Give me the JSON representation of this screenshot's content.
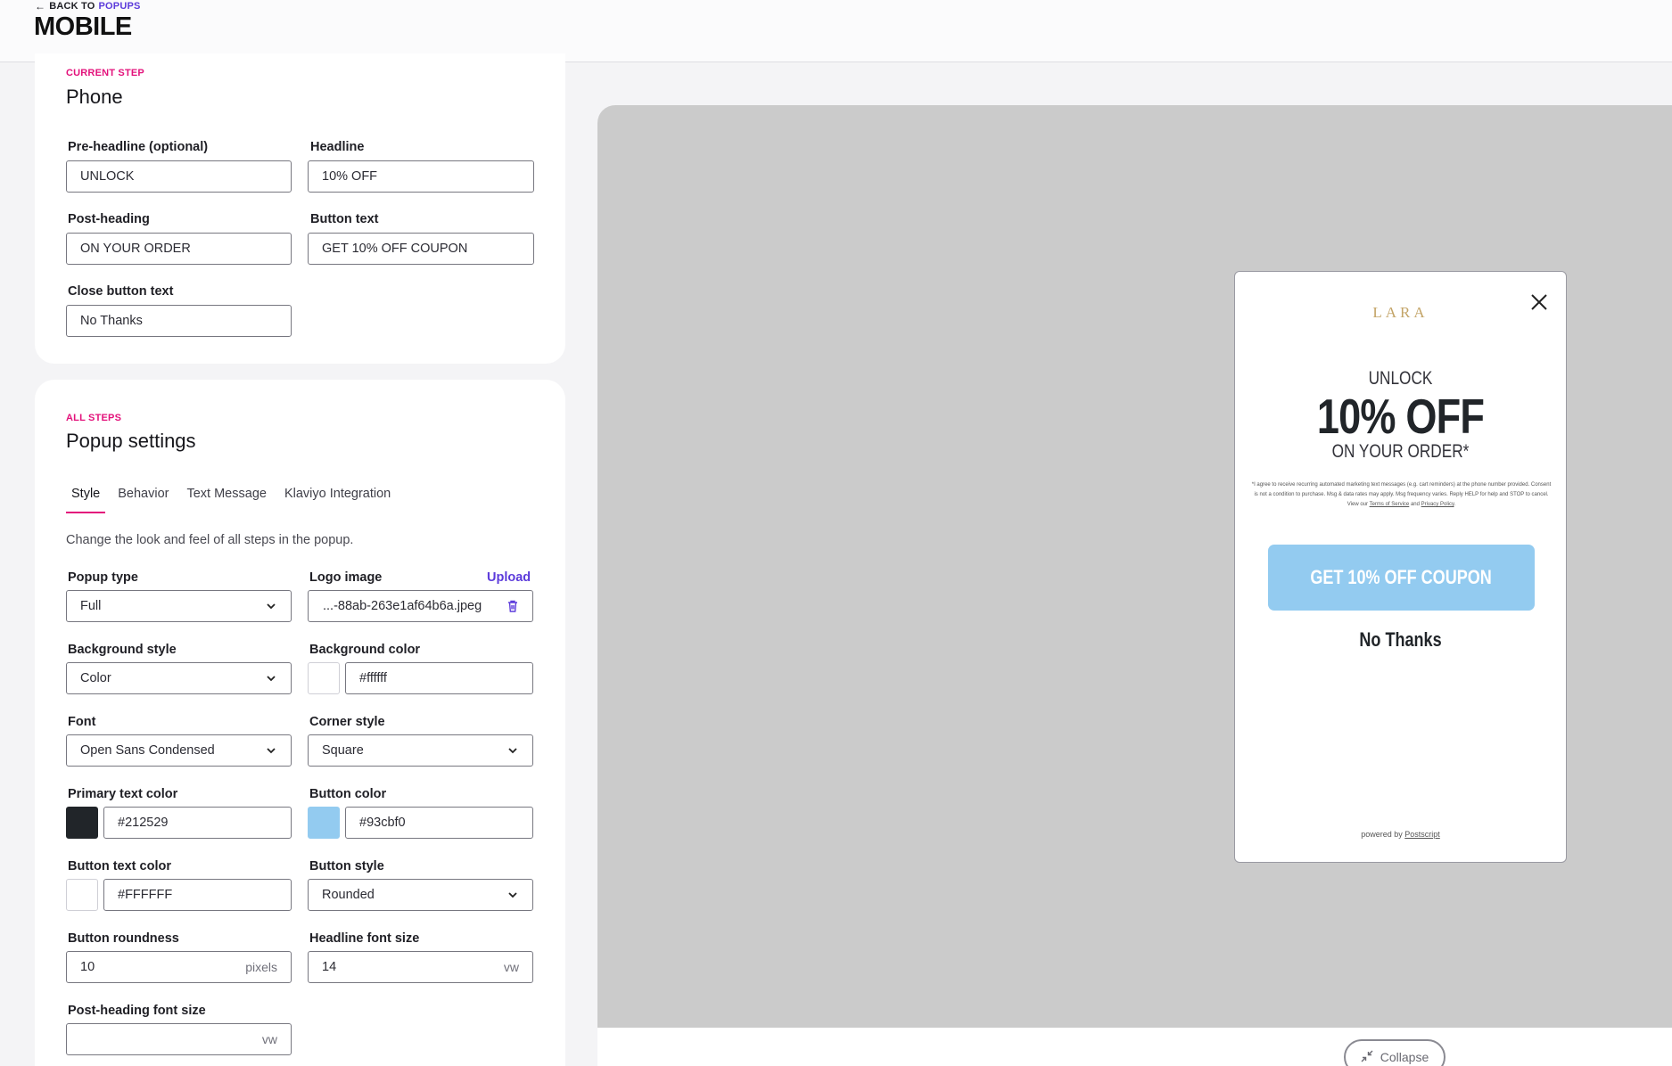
{
  "header": {
    "back_prefix": "BACK TO",
    "back_link": "POPUPS",
    "title": "MOBILE"
  },
  "current_step": {
    "eyebrow": "CURRENT STEP",
    "title": "Phone",
    "fields": {
      "preheadline_label": "Pre-headline (optional)",
      "preheadline_value": "UNLOCK",
      "headline_label": "Headline",
      "headline_value": "10% OFF",
      "postheading_label": "Post-heading",
      "postheading_value": "ON YOUR ORDER",
      "buttontext_label": "Button text",
      "buttontext_value": "GET 10% OFF COUPON",
      "closebutton_label": "Close button text",
      "closebutton_value": "No Thanks"
    }
  },
  "popup_settings": {
    "eyebrow": "ALL STEPS",
    "title": "Popup settings",
    "tabs": [
      "Style",
      "Behavior",
      "Text Message",
      "Klaviyo Integration"
    ],
    "description": "Change the look and feel of all steps in the popup.",
    "popup_type_label": "Popup type",
    "popup_type_value": "Full",
    "logo_label": "Logo image",
    "logo_upload": "Upload",
    "logo_value": "...-88ab-263e1af64b6a.jpeg",
    "bg_style_label": "Background style",
    "bg_style_value": "Color",
    "bg_color_label": "Background color",
    "bg_color_value": "#ffffff",
    "font_label": "Font",
    "font_value": "Open Sans Condensed",
    "corner_label": "Corner style",
    "corner_value": "Square",
    "primary_color_label": "Primary text color",
    "primary_color_value": "#212529",
    "button_color_label": "Button color",
    "button_color_value": "#93cbf0",
    "button_text_color_label": "Button text color",
    "button_text_color_value": "#FFFFFF",
    "button_style_label": "Button style",
    "button_style_value": "Rounded",
    "roundness_label": "Button roundness",
    "roundness_value": "10",
    "roundness_unit": "pixels",
    "headline_size_label": "Headline font size",
    "headline_size_value": "14",
    "headline_size_unit": "vw",
    "postheading_size_label": "Post-heading font size",
    "postheading_size_value": "",
    "postheading_size_unit": "vw"
  },
  "preview": {
    "logo": "LARA",
    "preheadline": "UNLOCK",
    "headline": "10% OFF",
    "postheading": "ON YOUR ORDER*",
    "legal_text": "*I agree to receive recurring automated marketing text messages (e.g. cart reminders) at the phone number provided. Consent is not a condition to purchase. Msg & data rates may apply. Msg frequency varies. Reply HELP for help and STOP to cancel. View our",
    "legal_terms": "Terms of Service",
    "legal_and": "and",
    "legal_privacy": "Privacy Policy",
    "button": "GET 10% OFF COUPON",
    "close_text": "No Thanks",
    "powered_prefix": "powered by",
    "powered_brand": "Postscript",
    "collapse": "Collapse"
  },
  "colors": {
    "accent_pink": "#e3127b",
    "accent_purple": "#5c3bdb",
    "primary_text": "#212529",
    "button": "#93cbf0",
    "button_text": "#FFFFFF",
    "background": "#ffffff"
  }
}
